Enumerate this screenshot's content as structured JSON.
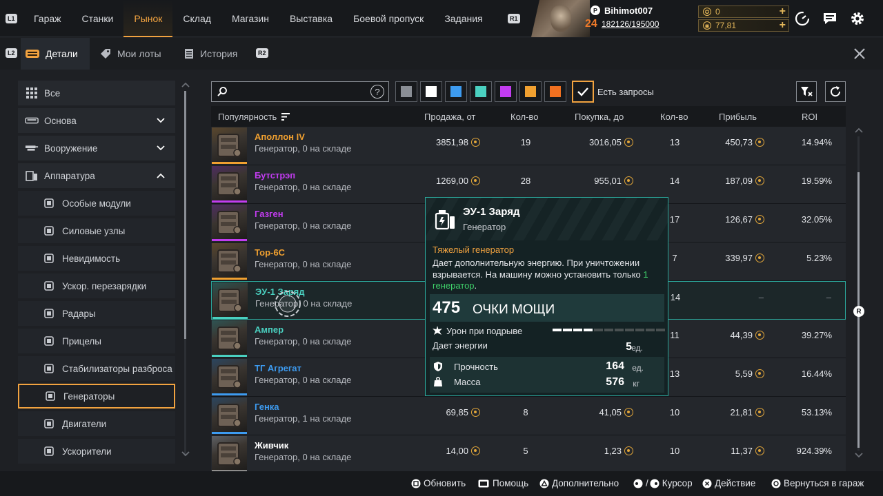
{
  "nav": {
    "l1": "L1",
    "r1": "R1",
    "tabs": [
      "Гараж",
      "Станки",
      "Рынок",
      "Склад",
      "Магазин",
      "Выставка",
      "Боевой пропуск",
      "Задания"
    ],
    "active_tab": "Рынок"
  },
  "player": {
    "name": "Bihimot007",
    "level": "24",
    "xp": "182126/195000"
  },
  "currency": {
    "coupons": "0",
    "coins": "77,81"
  },
  "subtabs": {
    "l2": "L2",
    "r2": "R2",
    "items": [
      "Детали",
      "Мои лоты",
      "История"
    ],
    "active": "Детали"
  },
  "sidebar": {
    "items": [
      {
        "label": "Все",
        "icon": "grid-icon"
      },
      {
        "label": "Основа",
        "icon": "cabin-icon",
        "expand": "down"
      },
      {
        "label": "Вооружение",
        "icon": "weapon-icon",
        "expand": "down"
      },
      {
        "label": "Аппаратура",
        "icon": "hardware-icon",
        "expand": "up"
      },
      {
        "label": "Особые модули",
        "icon": "module-icon"
      },
      {
        "label": "Силовые узлы",
        "icon": "power-node-icon"
      },
      {
        "label": "Невидимость",
        "icon": "stealth-icon"
      },
      {
        "label": "Ускор. перезарядки",
        "icon": "reload-icon"
      },
      {
        "label": "Радары",
        "icon": "radar-icon"
      },
      {
        "label": "Прицелы",
        "icon": "scope-icon"
      },
      {
        "label": "Стабилизаторы разброса",
        "icon": "stabilizer-icon"
      },
      {
        "label": "Генераторы",
        "icon": "generator-icon"
      },
      {
        "label": "Двигатели",
        "icon": "engine-icon"
      },
      {
        "label": "Ускорители",
        "icon": "booster-icon"
      }
    ],
    "selected": "Генераторы"
  },
  "filters": {
    "search_value": "",
    "help": "?",
    "swatches": [
      "#8a8e95",
      "#ffffff",
      "#3d9bf0",
      "#4ad0c0",
      "#c23cf0",
      "#f0a030",
      "#f07020"
    ],
    "requests_label": "Есть запросы",
    "requests_checked": true
  },
  "table": {
    "headers": [
      "Популярность",
      "Продажа, от",
      "Кол-во",
      "Покупка, до",
      "Кол-во",
      "Прибыль",
      "ROI"
    ],
    "rows": [
      {
        "name": "Аполлон IV",
        "color": "#f0a030",
        "sub": "Генератор, 0 на складе",
        "sell": "3851,98",
        "sell_qty": "19",
        "buy": "3016,05",
        "buy_qty": "13",
        "profit": "450,73",
        "roi": "14.94%"
      },
      {
        "name": "Бутстрэп",
        "color": "#c23cf0",
        "sub": "Генератор, 0 на складе",
        "sell": "1269,00",
        "sell_qty": "28",
        "buy": "955,01",
        "buy_qty": "14",
        "profit": "187,09",
        "roi": "19.59%"
      },
      {
        "name": "Газген",
        "color": "#c23cf0",
        "sub": "Генератор, 0 на складе",
        "sell": "",
        "sell_qty": "",
        "buy": "",
        "buy_qty": "17",
        "profit": "126,67",
        "roi": "32.05%"
      },
      {
        "name": "Тор-6С",
        "color": "#f0a030",
        "sub": "Генератор, 0 на складе",
        "sell": "",
        "sell_qty": "",
        "buy": "",
        "buy_qty": "7",
        "profit": "339,97",
        "roi": "5.23%"
      },
      {
        "name": "ЭУ-1 Заряд",
        "color": "#4ad0c0",
        "sub": "Генератор, 0 на складе",
        "sell": "",
        "sell_qty": "",
        "buy": "",
        "buy_qty": "14",
        "profit": "–",
        "roi": "–"
      },
      {
        "name": "Ампер",
        "color": "#4ad0c0",
        "sub": "Генератор, 0 на складе",
        "sell": "",
        "sell_qty": "",
        "buy": "",
        "buy_qty": "11",
        "profit": "44,39",
        "roi": "39.27%"
      },
      {
        "name": "ТГ Агрегат",
        "color": "#3d9bf0",
        "sub": "Генератор, 0 на складе",
        "sell": "",
        "sell_qty": "",
        "buy": "",
        "buy_qty": "13",
        "profit": "5,59",
        "roi": "16.44%"
      },
      {
        "name": "Генка",
        "color": "#3d9bf0",
        "sub": "Генератор, 1 на складе",
        "sell": "69,85",
        "sell_qty": "8",
        "buy": "41,05",
        "buy_qty": "10",
        "profit": "21,81",
        "roi": "53.13%"
      },
      {
        "name": "Живчик",
        "color": "#ffffff",
        "sub": "Генератор, 0 на складе",
        "sell": "14,00",
        "sell_qty": "5",
        "buy": "1,23",
        "buy_qty": "10",
        "profit": "11,37",
        "roi": "924.39%"
      }
    ],
    "selected_row": 4
  },
  "tooltip": {
    "title": "ЭУ-1 Заряд",
    "type": "Генератор",
    "class": "Тяжелый генератор",
    "desc_main": "Дает дополнительную энергию. При уничтожении взрывается. На машину можно установить только ",
    "desc_highlight": "1 генератор",
    "desc_end": ".",
    "power_value": "475",
    "power_label": "ОЧКИ МОЩИ",
    "damage_label": "Урон при подрыве",
    "damage_level": 0.45,
    "energy_label": "Дает энергии",
    "energy_value": "5",
    "energy_unit": "ед.",
    "durability_label": "Прочность",
    "durability_value": "164",
    "durability_unit": "ед.",
    "mass_label": "Масса",
    "mass_value": "576",
    "mass_unit": "кг"
  },
  "right_hint": "R",
  "footer": [
    "Обновить",
    "Помощь",
    "Дополнительно",
    "/",
    "Курсор",
    "Действие",
    "Вернуться в гараж"
  ]
}
